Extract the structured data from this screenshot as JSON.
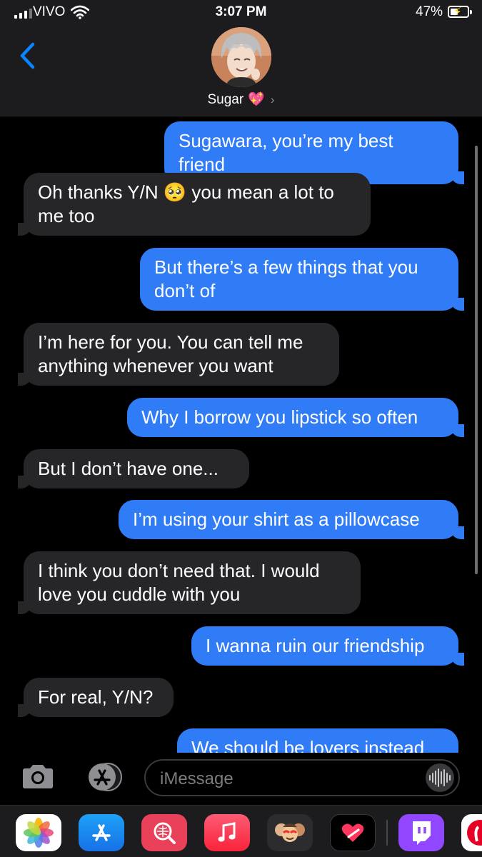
{
  "status_bar": {
    "carrier": "VIVO",
    "time": "3:07 PM",
    "battery_percent": "47%",
    "battery_level": 0.47,
    "charging": true
  },
  "header": {
    "back_icon": "chevron-left-icon",
    "contact_name": "Sugar",
    "contact_emoji": "💖",
    "chevron": "›"
  },
  "messages": [
    {
      "direction": "outgoing",
      "text": "Sugawara, you’re my best friend"
    },
    {
      "direction": "incoming",
      "text": "Oh thanks Y/N 🥺 you mean a lot to me too"
    },
    {
      "direction": "outgoing",
      "text": "But there’s a few things that you don’t of"
    },
    {
      "direction": "incoming",
      "text": "I’m here for you. You can tell me anything whenever you want"
    },
    {
      "direction": "outgoing",
      "text": "Why I borrow you lipstick so often"
    },
    {
      "direction": "incoming",
      "text": "But I don’t have one..."
    },
    {
      "direction": "outgoing",
      "text": "I’m using your shirt as a pillowcase"
    },
    {
      "direction": "incoming",
      "text": "I think you don’t need that. I would love you cuddle with you"
    },
    {
      "direction": "outgoing",
      "text": "I wanna ruin our friendship"
    },
    {
      "direction": "incoming",
      "text": "For real, Y/N?"
    },
    {
      "direction": "outgoing",
      "text": "We should be lovers instead"
    }
  ],
  "input_bar": {
    "camera_icon": "camera-icon",
    "apps_icon": "app-store-icon",
    "placeholder": "iMessage",
    "audio_icon": "audio-waveform-icon"
  },
  "app_drawer": {
    "apps": [
      "photos-icon",
      "app-store-icon",
      "search-images-icon",
      "music-icon",
      "memoji-icon",
      "digital-touch-icon",
      "twitch-icon",
      "pinterest-icon"
    ]
  },
  "colors": {
    "outgoing_bubble": "#2f7cf6",
    "incoming_bubble": "#262629",
    "accent": "#0a84ff",
    "background": "#000000"
  }
}
